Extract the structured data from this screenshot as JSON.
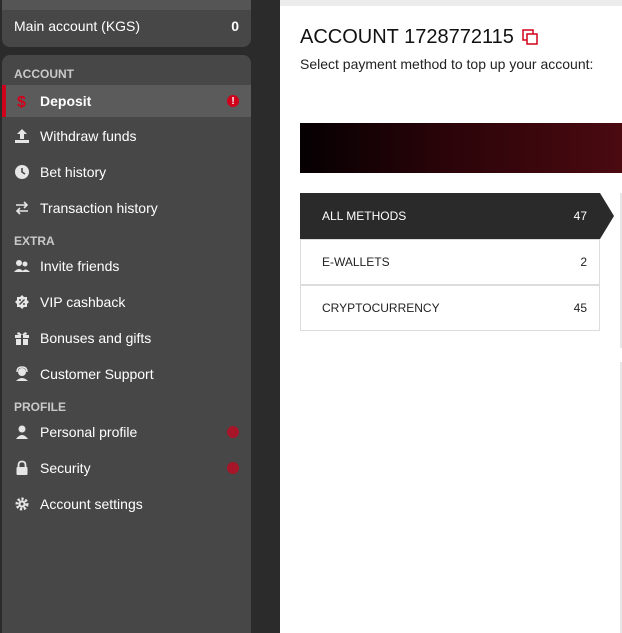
{
  "account_card": {
    "name": "Main account (KGS)",
    "balance": "0"
  },
  "sections": {
    "account": "ACCOUNT",
    "extra": "EXTRA",
    "profile": "PROFILE"
  },
  "menu": {
    "deposit": "Deposit",
    "withdraw": "Withdraw funds",
    "bet_history": "Bet history",
    "transaction_history": "Transaction history",
    "invite_friends": "Invite friends",
    "vip_cashback": "VIP cashback",
    "bonuses": "Bonuses and gifts",
    "support": "Customer Support",
    "personal_profile": "Personal profile",
    "security": "Security",
    "account_settings": "Account settings",
    "deposit_badge": "!"
  },
  "main": {
    "title": "ACCOUNT 1728772115",
    "subtitle": "Select payment method to top up your account:"
  },
  "methods": [
    {
      "label": "ALL METHODS",
      "count": "47"
    },
    {
      "label": "E-WALLETS",
      "count": "2"
    },
    {
      "label": "CRYPTOCURRENCY",
      "count": "45"
    }
  ],
  "colors": {
    "accent": "#d0021b",
    "sidebar": "#474747",
    "active_row": "#2a2a2a"
  }
}
